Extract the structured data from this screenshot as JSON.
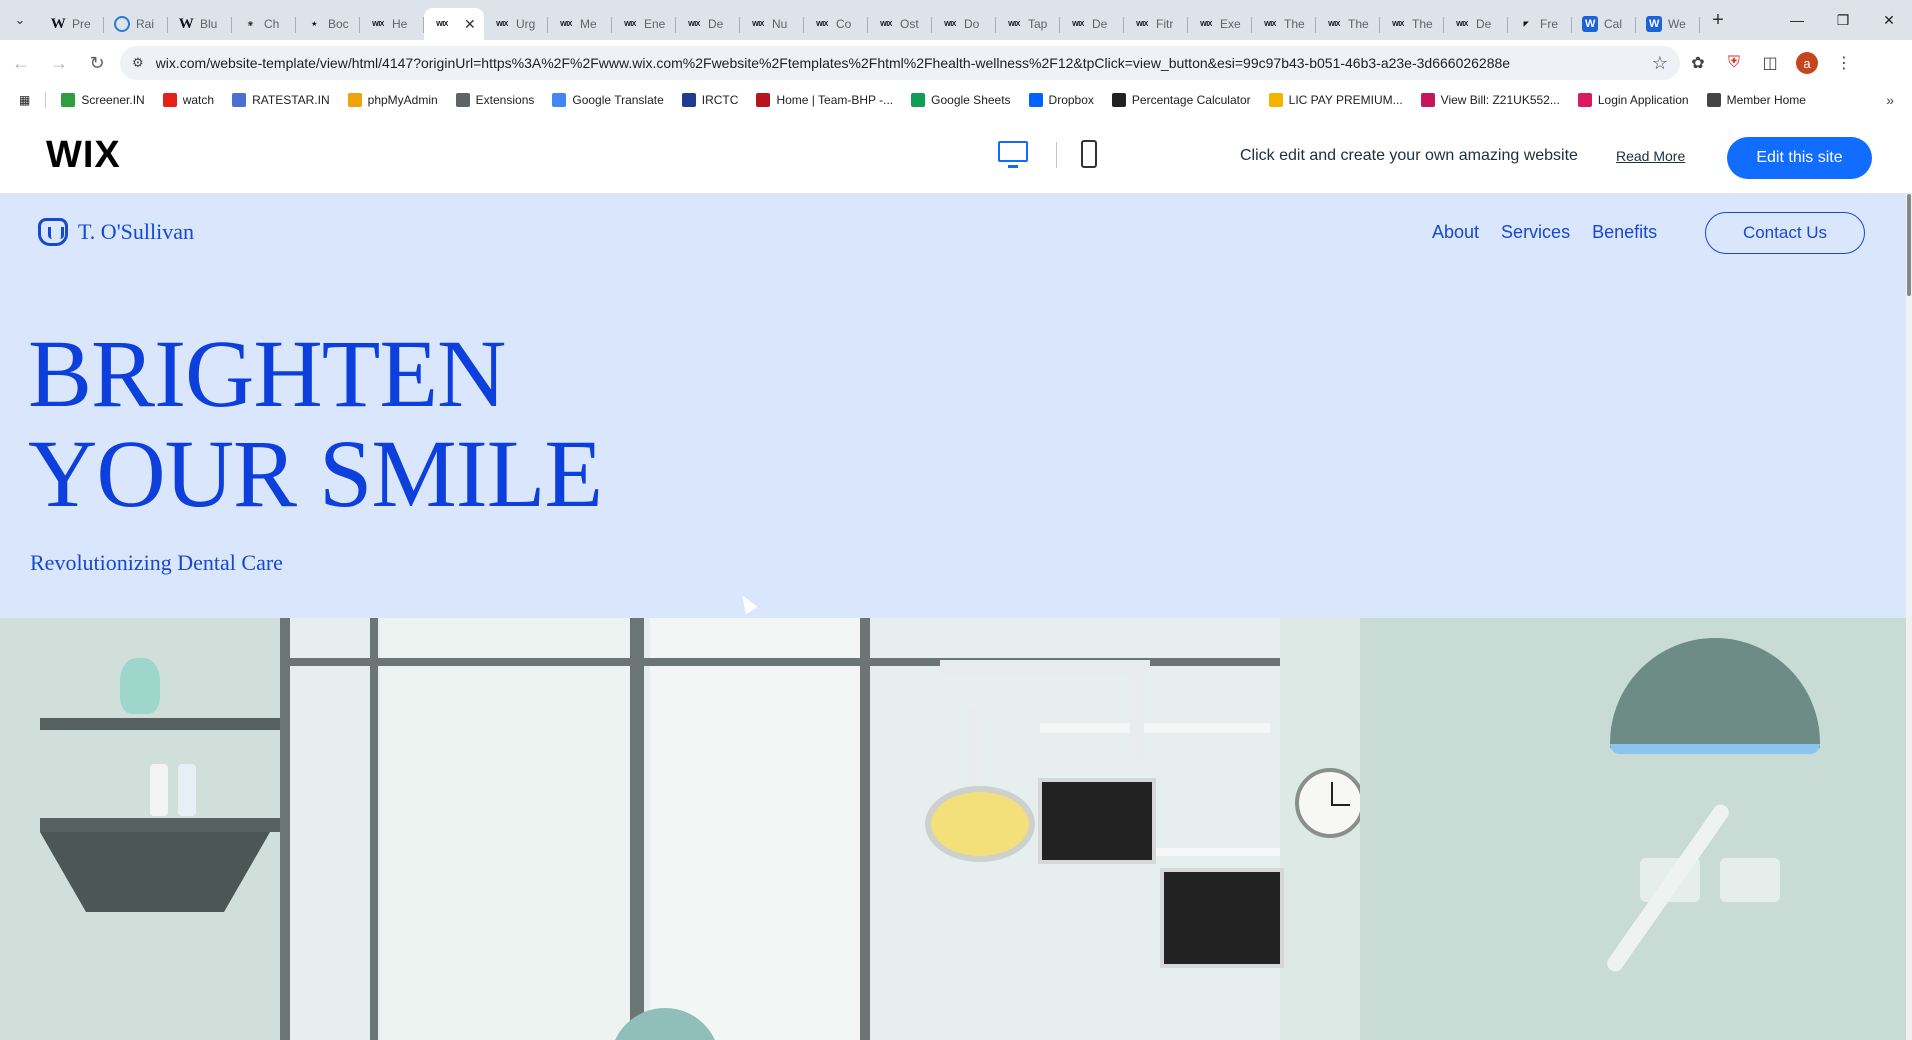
{
  "browser": {
    "tabs": [
      {
        "icon": "wikipedia-icon",
        "title": "Pre"
      },
      {
        "icon": "globe-icon",
        "title": "Rai"
      },
      {
        "icon": "wikipedia-icon",
        "title": "Blu"
      },
      {
        "icon": "chatgpt-icon",
        "title": "Ch"
      },
      {
        "icon": "star-bookmark-icon",
        "title": "Boc"
      },
      {
        "icon": "wix-icon",
        "title": "He"
      },
      {
        "icon": "wix-icon",
        "title": "",
        "active": true
      },
      {
        "icon": "wix-icon",
        "title": "Urg"
      },
      {
        "icon": "wix-icon",
        "title": "Me"
      },
      {
        "icon": "wix-icon",
        "title": "Ene"
      },
      {
        "icon": "wix-icon",
        "title": "De"
      },
      {
        "icon": "wix-icon",
        "title": "Nu"
      },
      {
        "icon": "wix-icon",
        "title": "Co"
      },
      {
        "icon": "wix-icon",
        "title": "Ost"
      },
      {
        "icon": "wix-icon",
        "title": "Do"
      },
      {
        "icon": "wix-icon",
        "title": "Tap"
      },
      {
        "icon": "wix-icon",
        "title": "De"
      },
      {
        "icon": "wix-icon",
        "title": "Fitr"
      },
      {
        "icon": "wix-icon",
        "title": "Exe"
      },
      {
        "icon": "wix-icon",
        "title": "The"
      },
      {
        "icon": "wix-icon",
        "title": "The"
      },
      {
        "icon": "wix-icon",
        "title": "The"
      },
      {
        "icon": "wix-icon",
        "title": "De"
      },
      {
        "icon": "framer-icon",
        "title": "Fre"
      },
      {
        "icon": "wix-blue-icon",
        "title": "Cal"
      },
      {
        "icon": "wix-blue-icon",
        "title": "We"
      }
    ],
    "url": "wix.com/website-template/view/html/4147?originUrl=https%3A%2F%2Fwww.wix.com%2Fwebsite%2Ftemplates%2Fhtml%2Fhealth-wellness%2F12&tpClick=view_button&esi=99c97b43-b051-46b3-a23e-3d666026288e",
    "avatar_letter": "a",
    "bookmarks": [
      {
        "label": "Screener.IN",
        "color": "#2e9e3e"
      },
      {
        "label": "watch",
        "color": "#e62117"
      },
      {
        "label": "RATESTAR.IN",
        "color": "#4a6fd0"
      },
      {
        "label": "phpMyAdmin",
        "color": "#f0a30a"
      },
      {
        "label": "Extensions",
        "color": "#5f6368"
      },
      {
        "label": "Google Translate",
        "color": "#4285f4"
      },
      {
        "label": "IRCTC",
        "color": "#1d3c8f"
      },
      {
        "label": "Home | Team-BHP -...",
        "color": "#b8141b"
      },
      {
        "label": "Google Sheets",
        "color": "#0f9d58"
      },
      {
        "label": "Dropbox",
        "color": "#0061fe"
      },
      {
        "label": "Percentage Calculator",
        "color": "#222222"
      },
      {
        "label": "LIC PAY PREMIUM...",
        "color": "#f4b400"
      },
      {
        "label": "View Bill: Z21UK552...",
        "color": "#c2185b"
      },
      {
        "label": "Login Application",
        "color": "#d81b60"
      },
      {
        "label": "Member Home",
        "color": "#444444"
      }
    ]
  },
  "wix": {
    "logo": "WIX",
    "tagline": "Click edit and create your own amazing website",
    "read_more": "Read More",
    "edit_button": "Edit this site"
  },
  "site": {
    "brand": "T. O'Sullivan",
    "nav": [
      "About",
      "Services",
      "Benefits"
    ],
    "contact": "Contact Us",
    "hero_line1": "BRIGHTEN",
    "hero_line2": "YOUR SMILE",
    "subtitle": "Revolutionizing Dental Care"
  },
  "colors": {
    "accent": "#0d3fdc",
    "site_bg": "#dae6fb",
    "wix_blue": "#116dff"
  }
}
